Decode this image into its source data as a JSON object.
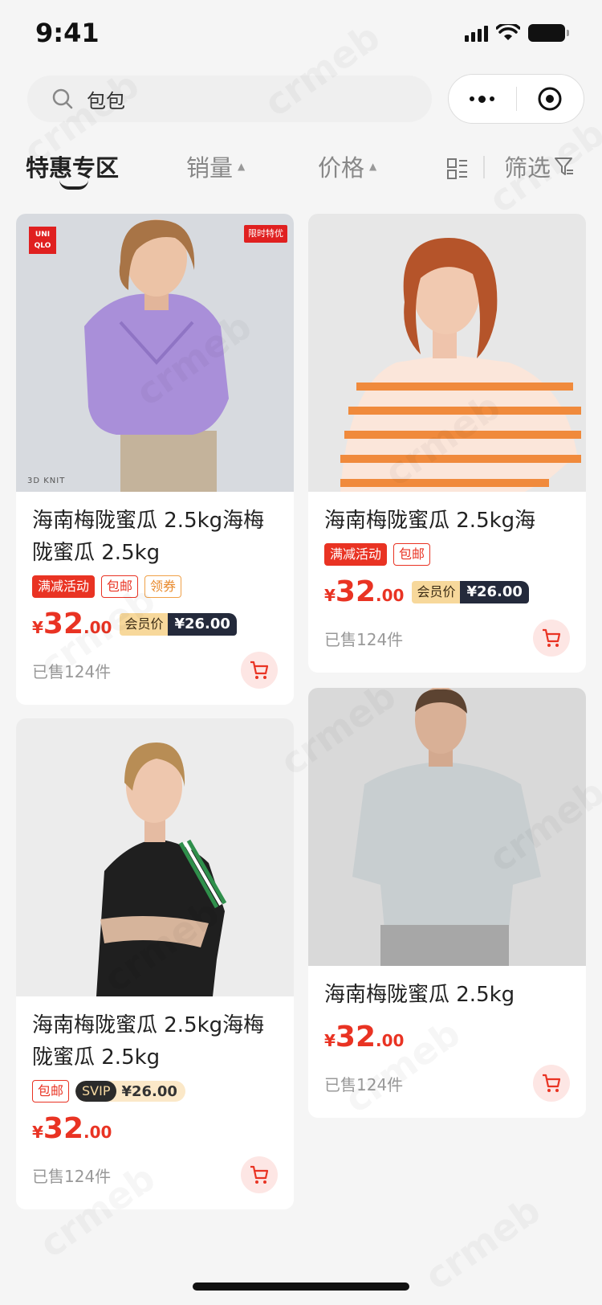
{
  "status_bar": {
    "time": "9:41"
  },
  "search": {
    "query": "包包"
  },
  "tabs": [
    {
      "label": "特惠专区"
    },
    {
      "label": "销量"
    },
    {
      "label": "价格"
    },
    {
      "label": "筛选"
    }
  ],
  "products": [
    {
      "title": "海南梅陇蜜瓜 2.5kg海梅陇蜜瓜 2.5kg",
      "tags": [
        "满减活动",
        "包邮",
        "领券"
      ],
      "price_int": "32",
      "price_dec": ".00",
      "currency": "¥",
      "member_label": "会员价",
      "member_price": "¥26.00",
      "sold": "已售124件",
      "brand_logo": "UNI QLO",
      "promo_badge": "限时特优",
      "knit_label": "3D KNIT"
    },
    {
      "title": "海南梅陇蜜瓜 2.5kg海",
      "tags": [
        "满减活动",
        "包邮"
      ],
      "price_int": "32",
      "price_dec": ".00",
      "currency": "¥",
      "member_label": "会员价",
      "member_price": "¥26.00",
      "sold": "已售124件"
    },
    {
      "title": "海南梅陇蜜瓜 2.5kg海梅陇蜜瓜 2.5kg",
      "tags": [
        "包邮"
      ],
      "svip_label": "SVIP",
      "svip_price": "¥26.00",
      "price_int": "32",
      "price_dec": ".00",
      "currency": "¥",
      "sold": "已售124件"
    },
    {
      "title": "海南梅陇蜜瓜 2.5kg",
      "price_int": "32",
      "price_dec": ".00",
      "currency": "¥",
      "sold": "已售124件"
    }
  ],
  "colors": {
    "accent": "#e93323",
    "background": "#f5f5f5"
  }
}
